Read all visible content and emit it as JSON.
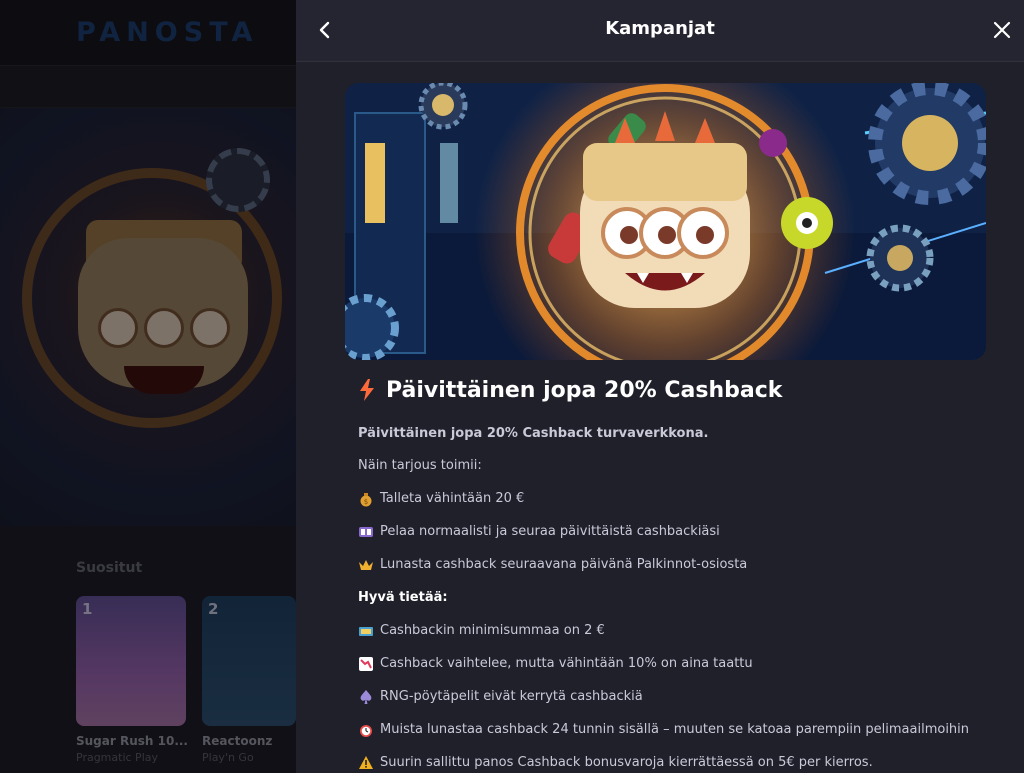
{
  "site": {
    "logo": "PANOSTA",
    "section_title": "Suositut",
    "games": [
      {
        "rank": "1",
        "name": "Sugar Rush 10...",
        "provider": "Pragmatic Play"
      },
      {
        "rank": "2",
        "name": "Reactoonz",
        "provider": "Play'n Go"
      }
    ]
  },
  "panel": {
    "title": "Kampanjat",
    "back_icon": "chevron-left-icon",
    "close_icon": "close-icon",
    "promo_title": "Päivittäinen jopa 20% Cashback",
    "lede": "Päivittäinen jopa 20% Cashback turvaverkkona.",
    "how_label": "Näin tarjous toimii:",
    "steps": [
      {
        "icon": "money-bag-icon",
        "text": "Talleta vähintään 20 €"
      },
      {
        "icon": "slot-icon",
        "text": "Pelaa normaalisti ja seuraa päivittäistä cashbackiäsi"
      },
      {
        "icon": "crown-icon",
        "text": "Lunasta cashback seuraavana päivänä Palkinnot-osiosta"
      }
    ],
    "good_to_know": "Hyvä tietää:",
    "facts": [
      {
        "icon": "cash-icon",
        "text": "Cashbackin minimisummaa on 2 €"
      },
      {
        "icon": "chart-down-icon",
        "text": "Cashback vaihtelee, mutta vähintään 10% on aina taattu"
      },
      {
        "icon": "spade-icon",
        "text": "RNG-pöytäpelit eivät kerrytä cashbackiä"
      },
      {
        "icon": "alarm-clock-icon",
        "text": "Muista lunastaa cashback 24 tunnin sisällä – muuten se katoaa parempiin pelimaailmoihin"
      },
      {
        "icon": "warning-icon",
        "text": "Suurin sallittu panos Cashback bonusvaroja kierrättäessä on 5€ per kierros."
      }
    ]
  }
}
